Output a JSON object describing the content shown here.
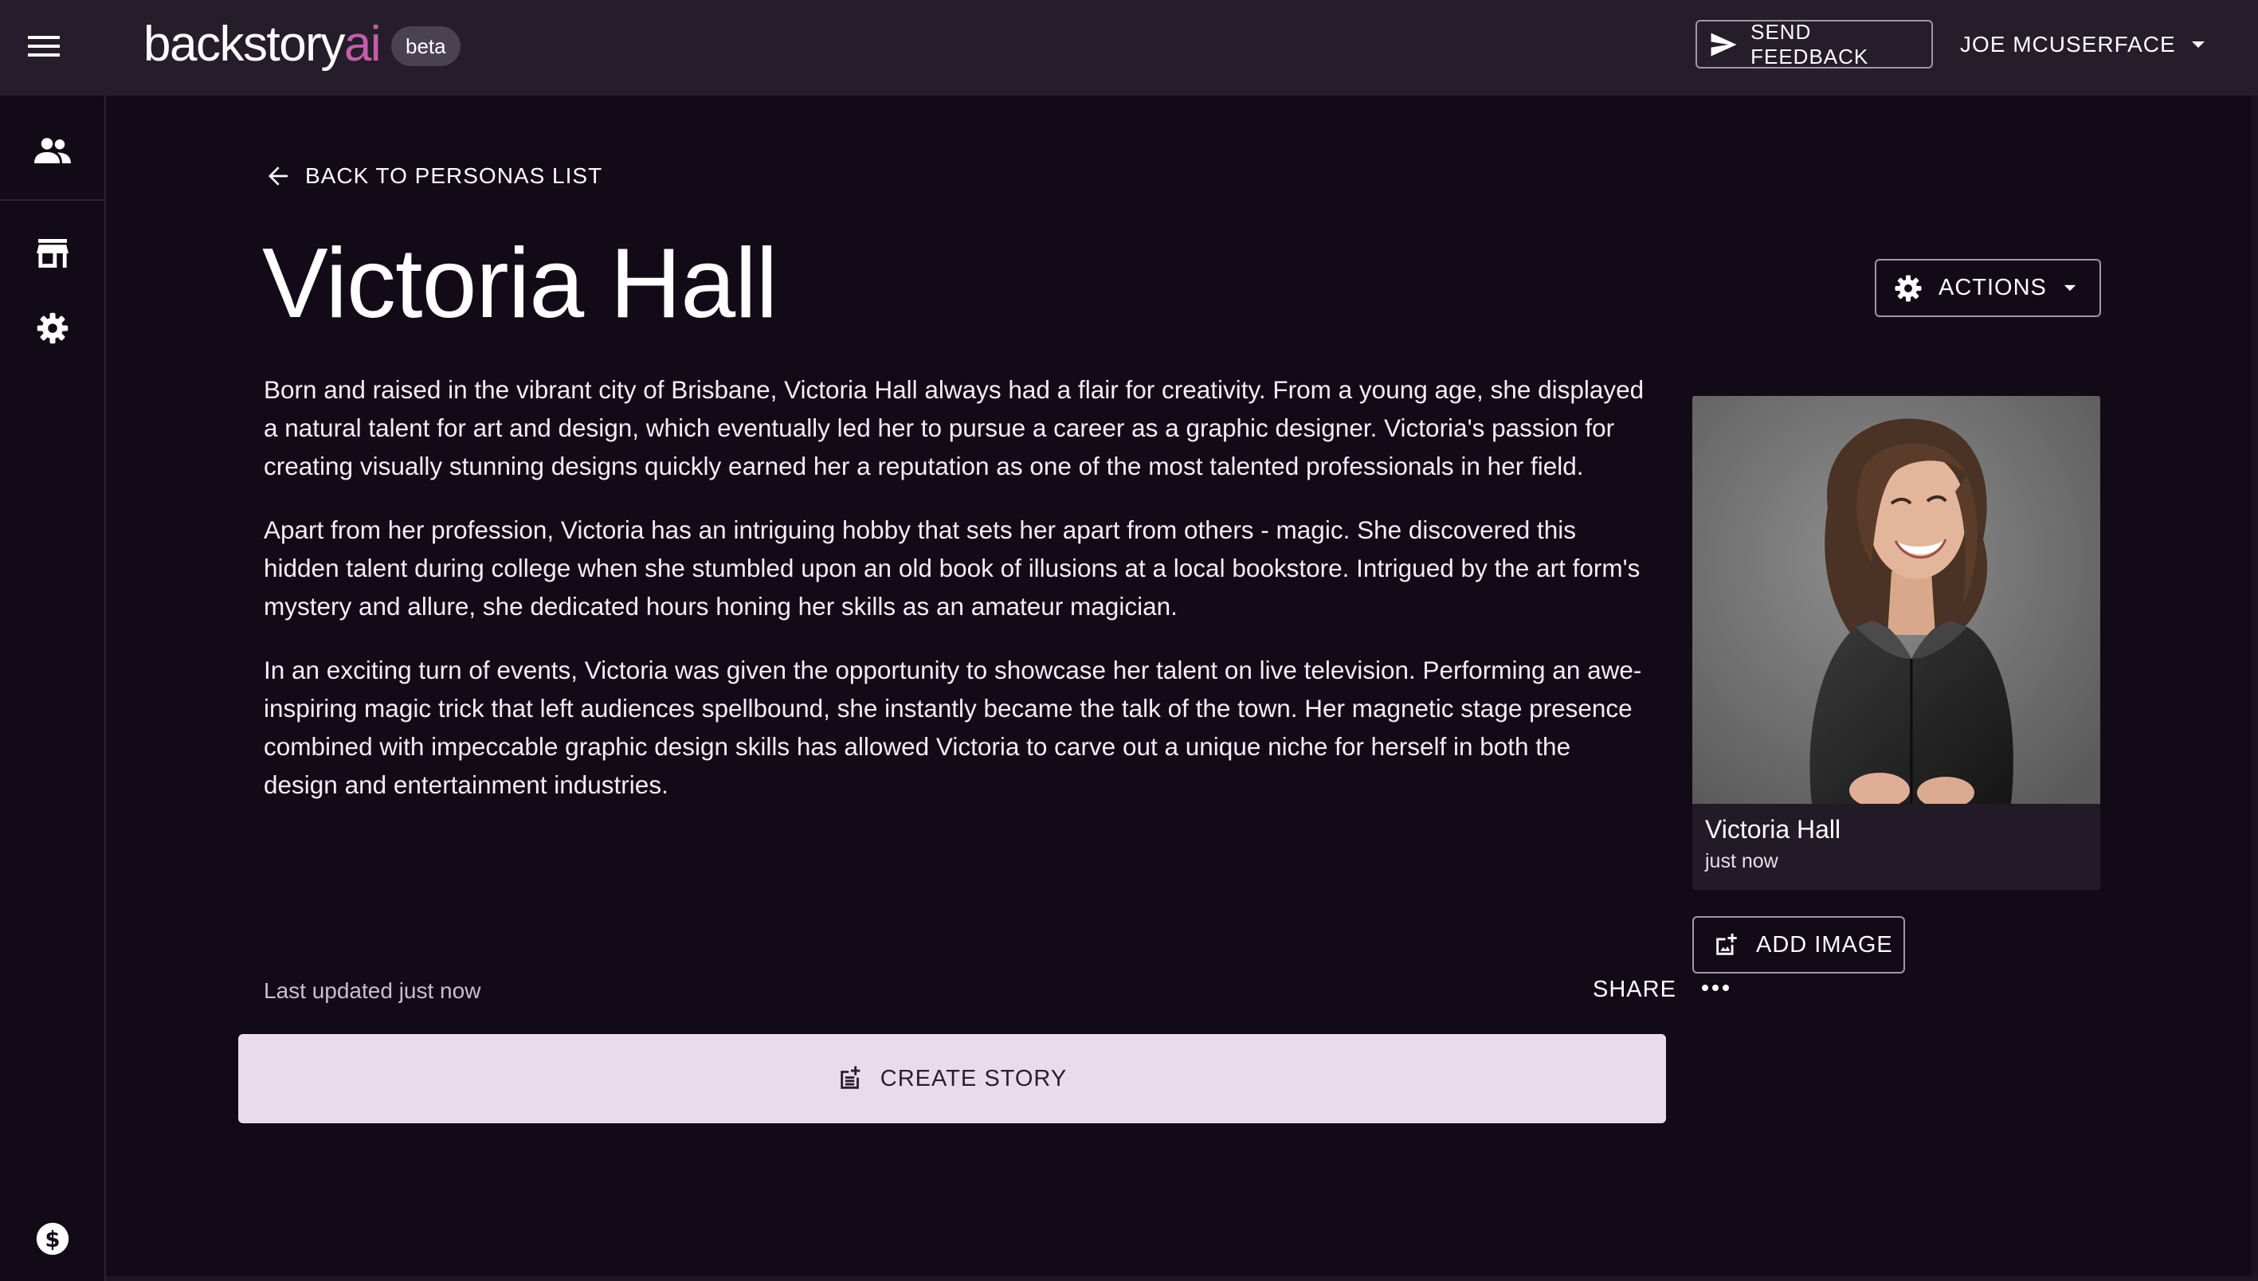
{
  "app": {
    "logo_main": "backstory",
    "logo_accent": "ai",
    "badge": "beta"
  },
  "header": {
    "menu_icon": "hamburger-menu-icon",
    "feedback_label": "SEND FEEDBACK",
    "user_name": "JOE MCUSERFACE"
  },
  "sidebar": {
    "items": [
      {
        "icon": "people-icon"
      },
      {
        "icon": "store-icon"
      },
      {
        "icon": "gear-icon"
      },
      {
        "icon": "dollar-icon"
      }
    ]
  },
  "persona": {
    "back_label": "BACK TO PERSONAS LIST",
    "name": "Victoria Hall",
    "actions_label": "ACTIONS",
    "bio": [
      "Born and raised in the vibrant city of Brisbane, Victoria Hall always had a flair for creativity. From a young age, she displayed a natural talent for art and design, which eventually led her to pursue a career as a graphic designer. Victoria's passion for creating visually stunning designs quickly earned her a reputation as one of the most talented professionals in her field.",
      "Apart from her profession, Victoria has an intriguing hobby that sets her apart from others - magic. She discovered this hidden talent during college when she stumbled upon an old book of illusions at a local bookstore. Intrigued by the art form's mystery and allure, she dedicated hours honing her skills as an amateur magician.",
      "In an exciting turn of events, Victoria was given the opportunity to showcase her talent on live television. Performing an awe-inspiring magic trick that left audiences spellbound, she instantly became the talk of the town. Her magnetic stage presence combined with impeccable graphic design skills has allowed Victoria to carve out a unique niche for herself in both the design and entertainment industries."
    ],
    "last_updated": "Last updated just now",
    "share_label": "SHARE",
    "card": {
      "name": "Victoria Hall",
      "time": "just now"
    },
    "add_image_label": "ADD IMAGE",
    "create_story_label": "CREATE STORY"
  },
  "colors": {
    "background": "#130a18",
    "topbar": "#261d2b",
    "accent": "#c45ea8",
    "create_story_bg": "#e9dbec"
  }
}
